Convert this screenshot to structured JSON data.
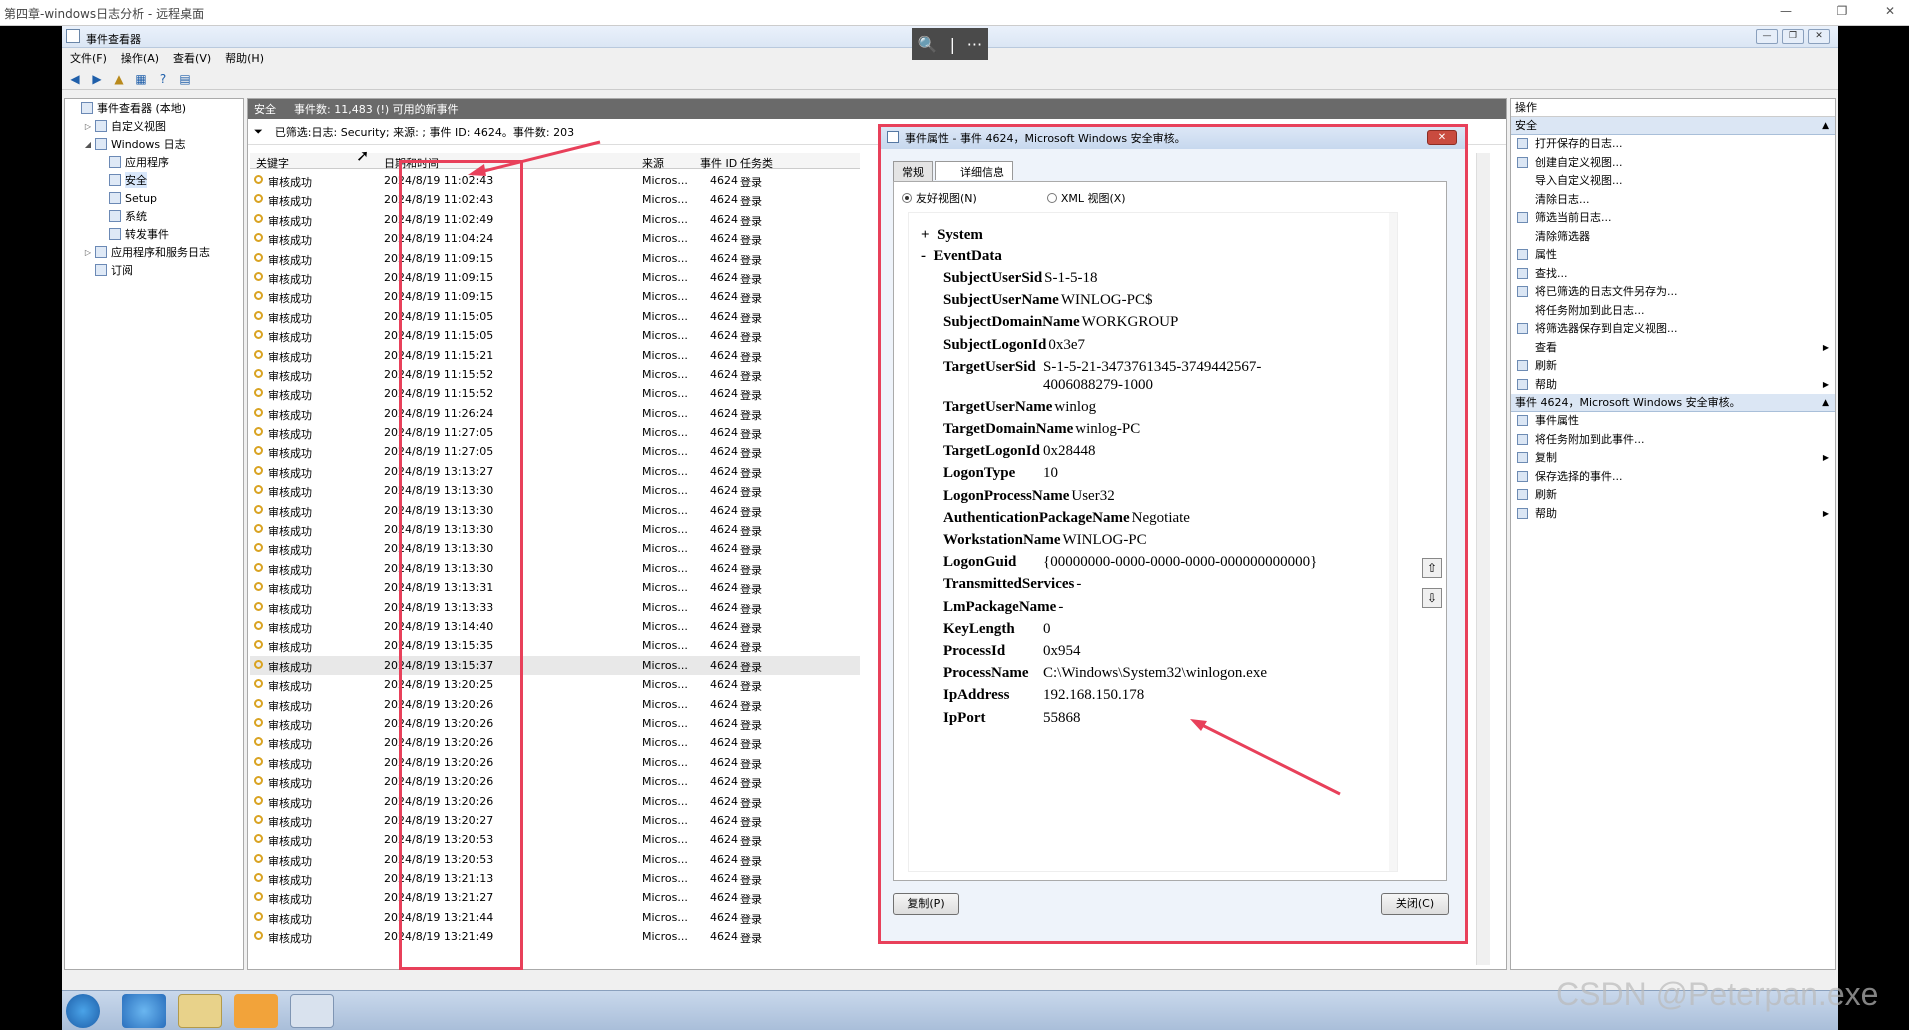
{
  "outer_title": "第四章-windows日志分析 - 远程桌面",
  "remote_bar": {
    "zoom": "🔍",
    "sep": "|",
    "more": "···"
  },
  "window": {
    "title": "事件查看器",
    "menu": [
      "文件(F)",
      "操作(A)",
      "查看(V)",
      "帮助(H)"
    ]
  },
  "tree": {
    "items": [
      {
        "label": "事件查看器 (本地)",
        "indent": 0,
        "toggle": ""
      },
      {
        "label": "自定义视图",
        "indent": 1,
        "toggle": "▷"
      },
      {
        "label": "Windows 日志",
        "indent": 1,
        "toggle": "◢"
      },
      {
        "label": "应用程序",
        "indent": 2,
        "toggle": ""
      },
      {
        "label": "安全",
        "indent": 2,
        "toggle": ""
      },
      {
        "label": "Setup",
        "indent": 2,
        "toggle": ""
      },
      {
        "label": "系统",
        "indent": 2,
        "toggle": ""
      },
      {
        "label": "转发事件",
        "indent": 2,
        "toggle": ""
      },
      {
        "label": "应用程序和服务日志",
        "indent": 1,
        "toggle": "▷"
      },
      {
        "label": "订阅",
        "indent": 1,
        "toggle": ""
      }
    ],
    "selected": 4
  },
  "center": {
    "log_name": "安全",
    "count_text": "事件数: 11,483 (!) 可用的新事件",
    "filter_text": "已筛选:日志: Security; 来源: ; 事件 ID: 4624。事件数: 203",
    "columns": [
      "关键字",
      "日期和时间",
      "来源",
      "事件 ID",
      "任务类"
    ]
  },
  "rows": [
    {
      "kw": "审核成功",
      "dt": "2024/8/19 11:02:43",
      "src": "Micros...",
      "id": "4624",
      "cat": "登录"
    },
    {
      "kw": "审核成功",
      "dt": "2024/8/19 11:02:43",
      "src": "Micros...",
      "id": "4624",
      "cat": "登录"
    },
    {
      "kw": "审核成功",
      "dt": "2024/8/19 11:02:49",
      "src": "Micros...",
      "id": "4624",
      "cat": "登录"
    },
    {
      "kw": "审核成功",
      "dt": "2024/8/19 11:04:24",
      "src": "Micros...",
      "id": "4624",
      "cat": "登录"
    },
    {
      "kw": "审核成功",
      "dt": "2024/8/19 11:09:15",
      "src": "Micros...",
      "id": "4624",
      "cat": "登录"
    },
    {
      "kw": "审核成功",
      "dt": "2024/8/19 11:09:15",
      "src": "Micros...",
      "id": "4624",
      "cat": "登录"
    },
    {
      "kw": "审核成功",
      "dt": "2024/8/19 11:09:15",
      "src": "Micros...",
      "id": "4624",
      "cat": "登录"
    },
    {
      "kw": "审核成功",
      "dt": "2024/8/19 11:15:05",
      "src": "Micros...",
      "id": "4624",
      "cat": "登录"
    },
    {
      "kw": "审核成功",
      "dt": "2024/8/19 11:15:05",
      "src": "Micros...",
      "id": "4624",
      "cat": "登录"
    },
    {
      "kw": "审核成功",
      "dt": "2024/8/19 11:15:21",
      "src": "Micros...",
      "id": "4624",
      "cat": "登录"
    },
    {
      "kw": "审核成功",
      "dt": "2024/8/19 11:15:52",
      "src": "Micros...",
      "id": "4624",
      "cat": "登录"
    },
    {
      "kw": "审核成功",
      "dt": "2024/8/19 11:15:52",
      "src": "Micros...",
      "id": "4624",
      "cat": "登录"
    },
    {
      "kw": "审核成功",
      "dt": "2024/8/19 11:26:24",
      "src": "Micros...",
      "id": "4624",
      "cat": "登录"
    },
    {
      "kw": "审核成功",
      "dt": "2024/8/19 11:27:05",
      "src": "Micros...",
      "id": "4624",
      "cat": "登录"
    },
    {
      "kw": "审核成功",
      "dt": "2024/8/19 11:27:05",
      "src": "Micros...",
      "id": "4624",
      "cat": "登录"
    },
    {
      "kw": "审核成功",
      "dt": "2024/8/19 13:13:27",
      "src": "Micros...",
      "id": "4624",
      "cat": "登录"
    },
    {
      "kw": "审核成功",
      "dt": "2024/8/19 13:13:30",
      "src": "Micros...",
      "id": "4624",
      "cat": "登录"
    },
    {
      "kw": "审核成功",
      "dt": "2024/8/19 13:13:30",
      "src": "Micros...",
      "id": "4624",
      "cat": "登录"
    },
    {
      "kw": "审核成功",
      "dt": "2024/8/19 13:13:30",
      "src": "Micros...",
      "id": "4624",
      "cat": "登录"
    },
    {
      "kw": "审核成功",
      "dt": "2024/8/19 13:13:30",
      "src": "Micros...",
      "id": "4624",
      "cat": "登录"
    },
    {
      "kw": "审核成功",
      "dt": "2024/8/19 13:13:30",
      "src": "Micros...",
      "id": "4624",
      "cat": "登录"
    },
    {
      "kw": "审核成功",
      "dt": "2024/8/19 13:13:31",
      "src": "Micros...",
      "id": "4624",
      "cat": "登录"
    },
    {
      "kw": "审核成功",
      "dt": "2024/8/19 13:13:33",
      "src": "Micros...",
      "id": "4624",
      "cat": "登录"
    },
    {
      "kw": "审核成功",
      "dt": "2024/8/19 13:14:40",
      "src": "Micros...",
      "id": "4624",
      "cat": "登录"
    },
    {
      "kw": "审核成功",
      "dt": "2024/8/19 13:15:35",
      "src": "Micros...",
      "id": "4624",
      "cat": "登录"
    },
    {
      "kw": "审核成功",
      "dt": "2024/8/19 13:15:37",
      "src": "Micros...",
      "id": "4624",
      "cat": "登录"
    },
    {
      "kw": "审核成功",
      "dt": "2024/8/19 13:20:25",
      "src": "Micros...",
      "id": "4624",
      "cat": "登录"
    },
    {
      "kw": "审核成功",
      "dt": "2024/8/19 13:20:26",
      "src": "Micros...",
      "id": "4624",
      "cat": "登录"
    },
    {
      "kw": "审核成功",
      "dt": "2024/8/19 13:20:26",
      "src": "Micros...",
      "id": "4624",
      "cat": "登录"
    },
    {
      "kw": "审核成功",
      "dt": "2024/8/19 13:20:26",
      "src": "Micros...",
      "id": "4624",
      "cat": "登录"
    },
    {
      "kw": "审核成功",
      "dt": "2024/8/19 13:20:26",
      "src": "Micros...",
      "id": "4624",
      "cat": "登录"
    },
    {
      "kw": "审核成功",
      "dt": "2024/8/19 13:20:26",
      "src": "Micros...",
      "id": "4624",
      "cat": "登录"
    },
    {
      "kw": "审核成功",
      "dt": "2024/8/19 13:20:26",
      "src": "Micros...",
      "id": "4624",
      "cat": "登录"
    },
    {
      "kw": "审核成功",
      "dt": "2024/8/19 13:20:27",
      "src": "Micros...",
      "id": "4624",
      "cat": "登录"
    },
    {
      "kw": "审核成功",
      "dt": "2024/8/19 13:20:53",
      "src": "Micros...",
      "id": "4624",
      "cat": "登录"
    },
    {
      "kw": "审核成功",
      "dt": "2024/8/19 13:20:53",
      "src": "Micros...",
      "id": "4624",
      "cat": "登录"
    },
    {
      "kw": "审核成功",
      "dt": "2024/8/19 13:21:13",
      "src": "Micros...",
      "id": "4624",
      "cat": "登录"
    },
    {
      "kw": "审核成功",
      "dt": "2024/8/19 13:21:27",
      "src": "Micros...",
      "id": "4624",
      "cat": "登录"
    },
    {
      "kw": "审核成功",
      "dt": "2024/8/19 13:21:44",
      "src": "Micros...",
      "id": "4624",
      "cat": "登录"
    },
    {
      "kw": "审核成功",
      "dt": "2024/8/19 13:21:49",
      "src": "Micros...",
      "id": "4624",
      "cat": "登录"
    }
  ],
  "highlight_row": 25,
  "dialog": {
    "title": "事件属性 - 事件 4624，Microsoft Windows 安全审核。",
    "close": "✕",
    "tabs": [
      "常规",
      "详细信息"
    ],
    "active_tab": 1,
    "radio_friendly": "友好视图(N)",
    "radio_xml": "XML 视图(X)",
    "system_label": "System",
    "system_toggle": "+",
    "eventdata_label": "EventData",
    "eventdata_toggle": "-",
    "fields": [
      {
        "k": "SubjectUserSid",
        "v": "S-1-5-18"
      },
      {
        "k": "SubjectUserName",
        "v": "WINLOG-PC$"
      },
      {
        "k": "SubjectDomainName",
        "v": "WORKGROUP"
      },
      {
        "k": "SubjectLogonId",
        "v": "0x3e7"
      },
      {
        "k": "TargetUserSid",
        "v": "S-1-5-21-3473761345-3749442567-",
        "v2": "4006088279-1000"
      },
      {
        "k": "TargetUserName",
        "v": "winlog"
      },
      {
        "k": "TargetDomainName",
        "v": "winlog-PC"
      },
      {
        "k": "TargetLogonId",
        "v": "0x28448"
      },
      {
        "k": "LogonType",
        "v": "10"
      },
      {
        "k": "LogonProcessName",
        "v": "User32"
      },
      {
        "k": "AuthenticationPackageName",
        "v": "Negotiate"
      },
      {
        "k": "WorkstationName",
        "v": "WINLOG-PC"
      },
      {
        "k": "LogonGuid",
        "v": "{00000000-0000-0000-0000-000000000000}"
      },
      {
        "k": "TransmittedServices",
        "v": "-"
      },
      {
        "k": "LmPackageName",
        "v": "-"
      },
      {
        "k": "KeyLength",
        "v": "0"
      },
      {
        "k": "ProcessId",
        "v": "0x954"
      },
      {
        "k": "ProcessName",
        "v": "C:\\Windows\\System32\\winlogon.exe"
      },
      {
        "k": "IpAddress",
        "v": "192.168.150.178"
      },
      {
        "k": "IpPort",
        "v": "55868"
      }
    ],
    "copy_btn": "复制(P)",
    "close_btn": "关闭(C)"
  },
  "actions": {
    "head": "操作",
    "section1": "安全",
    "items1": [
      {
        "label": "打开保存的日志...",
        "icon": "folder-open-icon",
        "sub": ""
      },
      {
        "label": "创建自定义视图...",
        "icon": "filter-icon",
        "sub": ""
      },
      {
        "label": "导入自定义视图...",
        "icon": "",
        "sub": ""
      },
      {
        "label": "清除日志...",
        "icon": "",
        "sub": ""
      },
      {
        "label": "筛选当前日志...",
        "icon": "filter-icon",
        "sub": ""
      },
      {
        "label": "清除筛选器",
        "icon": "",
        "sub": ""
      },
      {
        "label": "属性",
        "icon": "properties-icon",
        "sub": ""
      },
      {
        "label": "查找...",
        "icon": "find-icon",
        "sub": ""
      },
      {
        "label": "将已筛选的日志文件另存为...",
        "icon": "save-icon",
        "sub": ""
      },
      {
        "label": "将任务附加到此日志...",
        "icon": "",
        "sub": ""
      },
      {
        "label": "将筛选器保存到自定义视图...",
        "icon": "filter-icon",
        "sub": ""
      },
      {
        "label": "查看",
        "icon": "",
        "sub": "▶"
      },
      {
        "label": "刷新",
        "icon": "refresh-icon",
        "sub": ""
      },
      {
        "label": "帮助",
        "icon": "help-icon",
        "sub": "▶"
      }
    ],
    "section2": "事件 4624，Microsoft Windows 安全审核。",
    "items2": [
      {
        "label": "事件属性",
        "icon": "properties-icon",
        "sub": ""
      },
      {
        "label": "将任务附加到此事件...",
        "icon": "task-icon",
        "sub": ""
      },
      {
        "label": "复制",
        "icon": "copy-icon",
        "sub": "▶"
      },
      {
        "label": "保存选择的事件...",
        "icon": "save-icon",
        "sub": ""
      },
      {
        "label": "刷新",
        "icon": "refresh-icon",
        "sub": ""
      },
      {
        "label": "帮助",
        "icon": "help-icon",
        "sub": "▶"
      }
    ]
  },
  "watermark": "CSDN @Peterpan.exe",
  "colors": {
    "highlight_red": "#e8405a",
    "selection": "#d8e7fb",
    "header_gray": "#6a6a6a"
  }
}
